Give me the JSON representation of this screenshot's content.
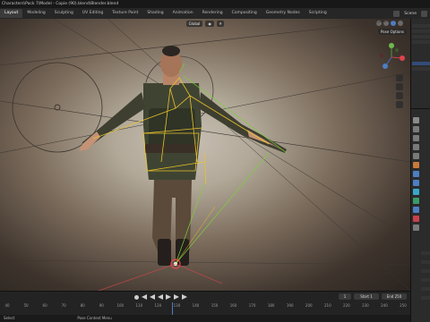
{
  "title_bar": {
    "text": "Characters\\Pack 7\\Model - Copie (90).blend\\Blender.blend"
  },
  "workspace_tabs": [
    {
      "label": "Layout",
      "active": true
    },
    {
      "label": "Modeling",
      "active": false
    },
    {
      "label": "Sculpting",
      "active": false
    },
    {
      "label": "UV Editing",
      "active": false
    },
    {
      "label": "Texture Paint",
      "active": false
    },
    {
      "label": "Shading",
      "active": false
    },
    {
      "label": "Animation",
      "active": false
    },
    {
      "label": "Rendering",
      "active": false
    },
    {
      "label": "Compositing",
      "active": false
    },
    {
      "label": "Geometry Nodes",
      "active": false
    },
    {
      "label": "Scripting",
      "active": false
    }
  ],
  "scene": {
    "label": "Scene"
  },
  "viewport": {
    "header_mode": "Global",
    "pose_options_label": "Pose Options"
  },
  "timeline": {
    "current_frame": "1",
    "start_label": "Start",
    "start_value": "1",
    "end_label": "End",
    "end_value": "250",
    "ruler_ticks": [
      "40",
      "50",
      "60",
      "70",
      "80",
      "90",
      "100",
      "110",
      "120",
      "130",
      "140",
      "150",
      "160",
      "170",
      "180",
      "190",
      "200",
      "210",
      "220",
      "230",
      "240",
      "250"
    ]
  },
  "status_bar": {
    "left": "Select",
    "center": "Pose Context Menu"
  },
  "colors": {
    "accent": "#4d7ec2",
    "bone_yellow": "#e8c22a",
    "bone_green": "#7ccf3a",
    "axis_red": "#e0444c"
  }
}
